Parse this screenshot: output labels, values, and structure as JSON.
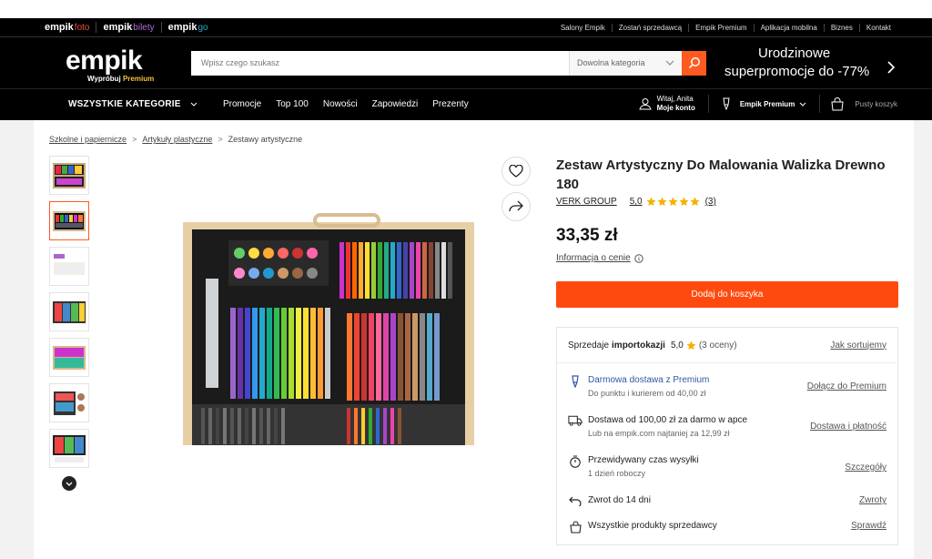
{
  "brands": [
    {
      "name": "empik",
      "suffix": "foto",
      "color": "#e8533a"
    },
    {
      "name": "empik",
      "suffix": "bilety",
      "color": "#9b59b6"
    },
    {
      "name": "empik",
      "suffix": "go",
      "color": "#29a9c6"
    }
  ],
  "top_links": [
    "Salony Empik",
    "Zostań sprzedawcą",
    "Empik Premium",
    "Aplikacja mobilna",
    "Biznes",
    "Kontakt"
  ],
  "logo": {
    "word": "empik",
    "tag_prefix": "Wypróbuj ",
    "tag_highlight": "Premium"
  },
  "search": {
    "placeholder": "Wpisz czego szukasz",
    "category": "Dowolna kategoria"
  },
  "promo": {
    "line1": "Urodzinowe",
    "line2": "superpromocje do -77%"
  },
  "nav": {
    "all_categories": "WSZYSTKIE KATEGORIE",
    "links": [
      "Promocje",
      "Top 100",
      "Nowości",
      "Zapowiedzi",
      "Prezenty"
    ],
    "account_line1": "Witaj, Anita",
    "account_line2": "Moje konto",
    "premium": "Empik Premium",
    "cart": "Pusty koszyk"
  },
  "breadcrumb": [
    "Szkolne i papiernicze",
    "Artykuły plastyczne",
    "Zestawy artystyczne"
  ],
  "product": {
    "title": "Zestaw Artystyczny Do Malowania Walizka Drewno 180",
    "seller": "VERK GROUP",
    "rating": "5,0",
    "rating_count": "(3)",
    "stars": 5,
    "price": "33,35 zł",
    "price_info": "Informacja o cenie",
    "add_to_cart": "Dodaj do koszyka"
  },
  "offer": {
    "seller_prefix": "Sprzedaje",
    "seller_name": "importokazji",
    "seller_rating": "5,0",
    "seller_reviews": "(3 oceny)",
    "sort_link": "Jak sortujemy",
    "rows": [
      {
        "icon": "premium-icon",
        "title": "Darmowa dostawa z Premium",
        "sub": "Do punktu i kurierem od 40,00 zł",
        "link": "Dołącz do Premium"
      },
      {
        "icon": "truck-icon",
        "title": "Dostawa od 100,00 zł za darmo w apce",
        "sub": "Lub na empik.com najtaniej za 12,99 zł",
        "link": "Dostawa i płatność"
      },
      {
        "icon": "timer-icon",
        "title": "Przewidywany czas wysyłki",
        "sub": "1 dzień roboczy",
        "link": "Szczegóły"
      },
      {
        "icon": "return-icon",
        "title": "Zwrot do 14 dni",
        "sub": "",
        "link": "Zwroty"
      },
      {
        "icon": "bag-icon",
        "title": "Wszystkie produkty sprzedawcy",
        "sub": "",
        "link": "Sprawdź"
      }
    ]
  },
  "colors": {
    "accent": "#ff4a0f",
    "premium_blue": "#3157a6",
    "star": "#f5b301"
  }
}
